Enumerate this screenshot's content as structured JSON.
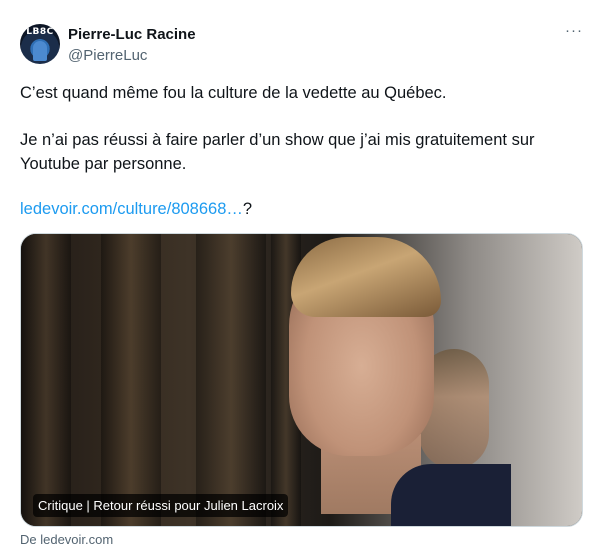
{
  "author": {
    "display_name": "Pierre-Luc Racine",
    "handle": "@PierreLuc",
    "avatar_text": "LB8C"
  },
  "tweet": {
    "paragraph1": "C’est quand même fou la culture de la vedette au Québec.",
    "paragraph2": "Je n’ai pas réussi à faire parler d’un show que j’ai mis gratuitement sur Youtube par personne.",
    "link_text": "ledevoir.com/culture/808668…",
    "link_suffix": "?"
  },
  "card": {
    "caption": "Critique | Retour réussi pour Julien Lacroix",
    "source": "De ledevoir.com"
  },
  "menu": {
    "more_label": "···"
  }
}
